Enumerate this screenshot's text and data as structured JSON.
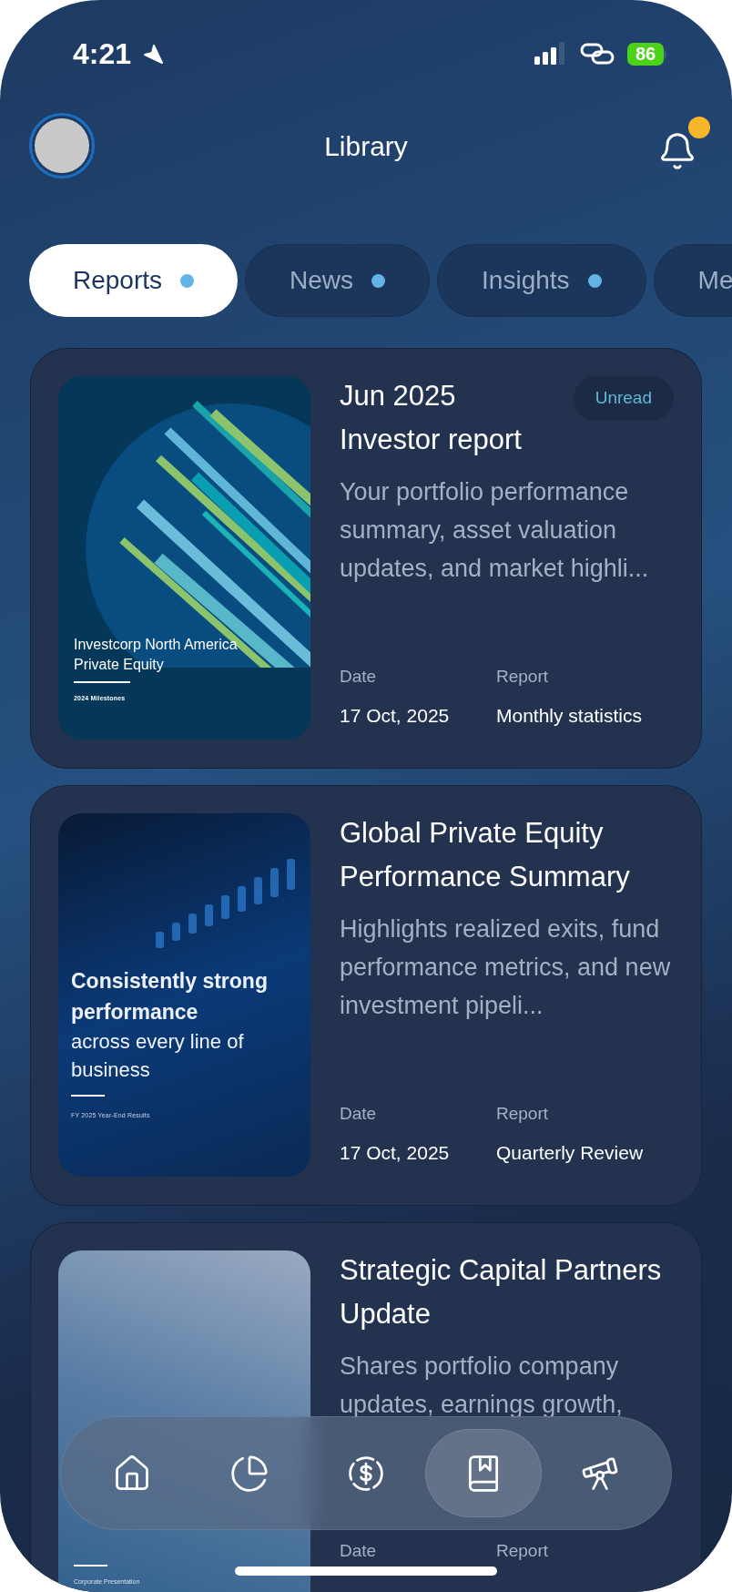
{
  "status_bar": {
    "time": "4:21",
    "battery": "86"
  },
  "header": {
    "title": "Library",
    "has_notification": true
  },
  "tabs": [
    {
      "label": "Reports",
      "selected": true,
      "dot": true
    },
    {
      "label": "News",
      "selected": false,
      "dot": true
    },
    {
      "label": "Insights",
      "selected": false,
      "dot": true
    },
    {
      "label": "Me",
      "selected": false
    }
  ],
  "cards": [
    {
      "cover": {
        "kind": "lines",
        "texts": [
          "Investcorp North America Private Equity",
          "2024 Milestones"
        ]
      },
      "title": "Jun 2025 Investor report",
      "badge": "Unread",
      "description": "Your portfolio performance summary, asset valuation updates, and market highli...",
      "date_label": "Date",
      "date": "17 Oct, 2025",
      "report_label": "Report",
      "report": "Monthly statistics"
    },
    {
      "cover": {
        "kind": "chart",
        "texts": [
          "Consistently strong performance",
          "across every line of business",
          "FY 2025 Year-End Results"
        ]
      },
      "title": "Global Private Equity Performance Summary",
      "description": "Highlights realized exits, fund performance metrics, and new investment pipeli...",
      "date_label": "Date",
      "date": "17 Oct, 2025",
      "report_label": "Report",
      "report": "Quarterly Review"
    },
    {
      "cover": {
        "kind": "sky",
        "texts": [
          "Corporate Presentation"
        ]
      },
      "title": "Strategic Capital Partners Update",
      "description": "Shares portfolio company updates, earnings growth,",
      "date_label": "Date",
      "report_label": "Report"
    }
  ],
  "nav": [
    {
      "kind": "home",
      "selected": false
    },
    {
      "kind": "pie",
      "selected": false
    },
    {
      "kind": "dollar",
      "selected": false
    },
    {
      "kind": "book",
      "selected": true
    },
    {
      "kind": "telescope",
      "selected": false
    }
  ]
}
